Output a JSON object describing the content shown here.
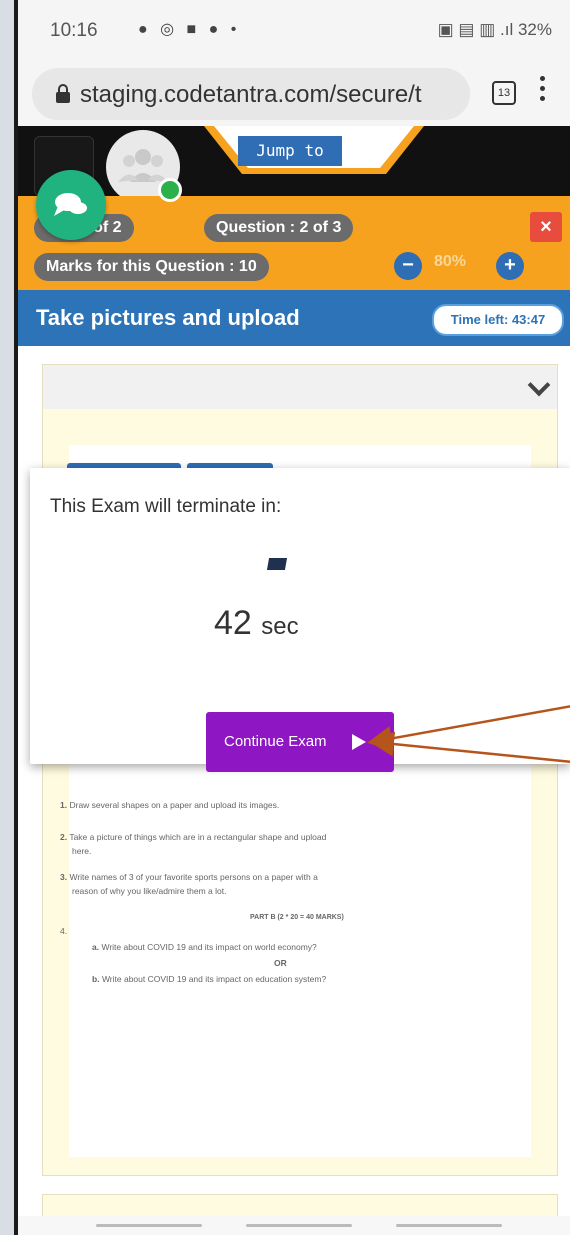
{
  "status_bar": {
    "time": "10:16",
    "notification_icons": "● ◎ ■ ● •",
    "system_icons": "▣ ▤ ▥ .ıl",
    "battery": "32%"
  },
  "browser": {
    "url": "staging.codetantra.com/secure/t",
    "tab_count": "13"
  },
  "header": {
    "jump_label": "Jump to"
  },
  "exam_bar": {
    "section": "on : 1 of 2",
    "question": "Question : 2 of 3",
    "marks": "Marks for this Question : 10",
    "close_glyph": "×",
    "zoom_minus": "−",
    "zoom_plus": "+",
    "zoom": "80%"
  },
  "title_bar": {
    "title": "Take pictures and upload",
    "time_left": "Time left: 43:47"
  },
  "modal": {
    "message": "This Exam will terminate in:",
    "countdown": "42",
    "unit": "sec",
    "continue_label": "Continue Exam"
  },
  "document": {
    "items": [
      {
        "num": "1.",
        "text": "Draw several shapes on a paper and upload its images."
      },
      {
        "num": "2.",
        "text": "Take a picture of things which are in a rectangular shape and upload"
      },
      {
        "num": "",
        "text": "here."
      },
      {
        "num": "3.",
        "text": "Write names of 3 of your favorite sports persons on a paper with a"
      },
      {
        "num": "",
        "text": "reason of why you like/admire them a lot."
      }
    ],
    "part_heading": "PART B (2 * 20 = 40 MARKS)",
    "q4_num": "4.",
    "option_a_num": "a.",
    "option_a": "Write about COVID 19 and its impact on world economy?",
    "or_label": "OR",
    "option_b_num": "b.",
    "option_b": "Write about COVID 19 and its impact on education system?"
  },
  "colors": {
    "orange": "#f6a21e",
    "blue": "#2c73b8",
    "purple": "#8e16c3",
    "close_red": "#e74c3c",
    "annotation": "#b5541b"
  }
}
